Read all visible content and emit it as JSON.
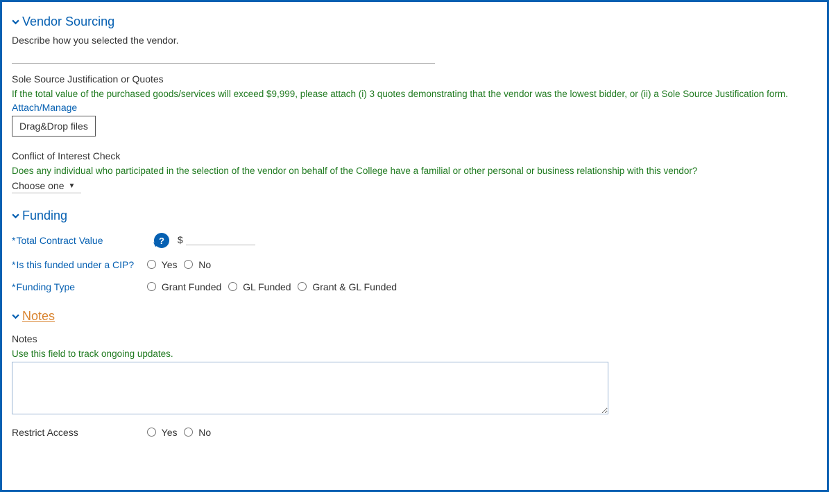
{
  "vendorSourcing": {
    "title": "Vendor Sourcing",
    "describeLabel": "Describe how you selected the vendor.",
    "describeValue": "",
    "soleSourceLabel": "Sole Source Justification or Quotes",
    "soleSourceHelp": "If the total value of the purchased goods/services will exceed $9,999, please attach (i) 3 quotes demonstrating that the vendor was the lowest bidder, or (ii) a Sole Source Justification form.",
    "attachLink": "Attach/Manage",
    "dropBox": "Drag&Drop files",
    "coiLabel": "Conflict of Interest Check",
    "coiHelp": "Does any individual who participated in the selection of the vendor on behalf of the College have a familial or other personal or business relationship with this vendor?",
    "coiSelected": "Choose one"
  },
  "funding": {
    "title": "Funding",
    "totalLabel": "Total Contract Value",
    "currency": "$",
    "totalValue": "",
    "helpIcon": "?",
    "cipLabel": "Is this funded under a CIP?",
    "cipOptions": {
      "yes": "Yes",
      "no": "No"
    },
    "typeLabel": "Funding Type",
    "typeOptions": {
      "grant": "Grant Funded",
      "gl": "GL Funded",
      "both": "Grant & GL Funded"
    }
  },
  "notes": {
    "title": "Notes",
    "fieldLabel": "Notes",
    "help": "Use this field to track ongoing updates.",
    "value": "",
    "restrictLabel": "Restrict Access",
    "restrictOptions": {
      "yes": "Yes",
      "no": "No"
    }
  }
}
